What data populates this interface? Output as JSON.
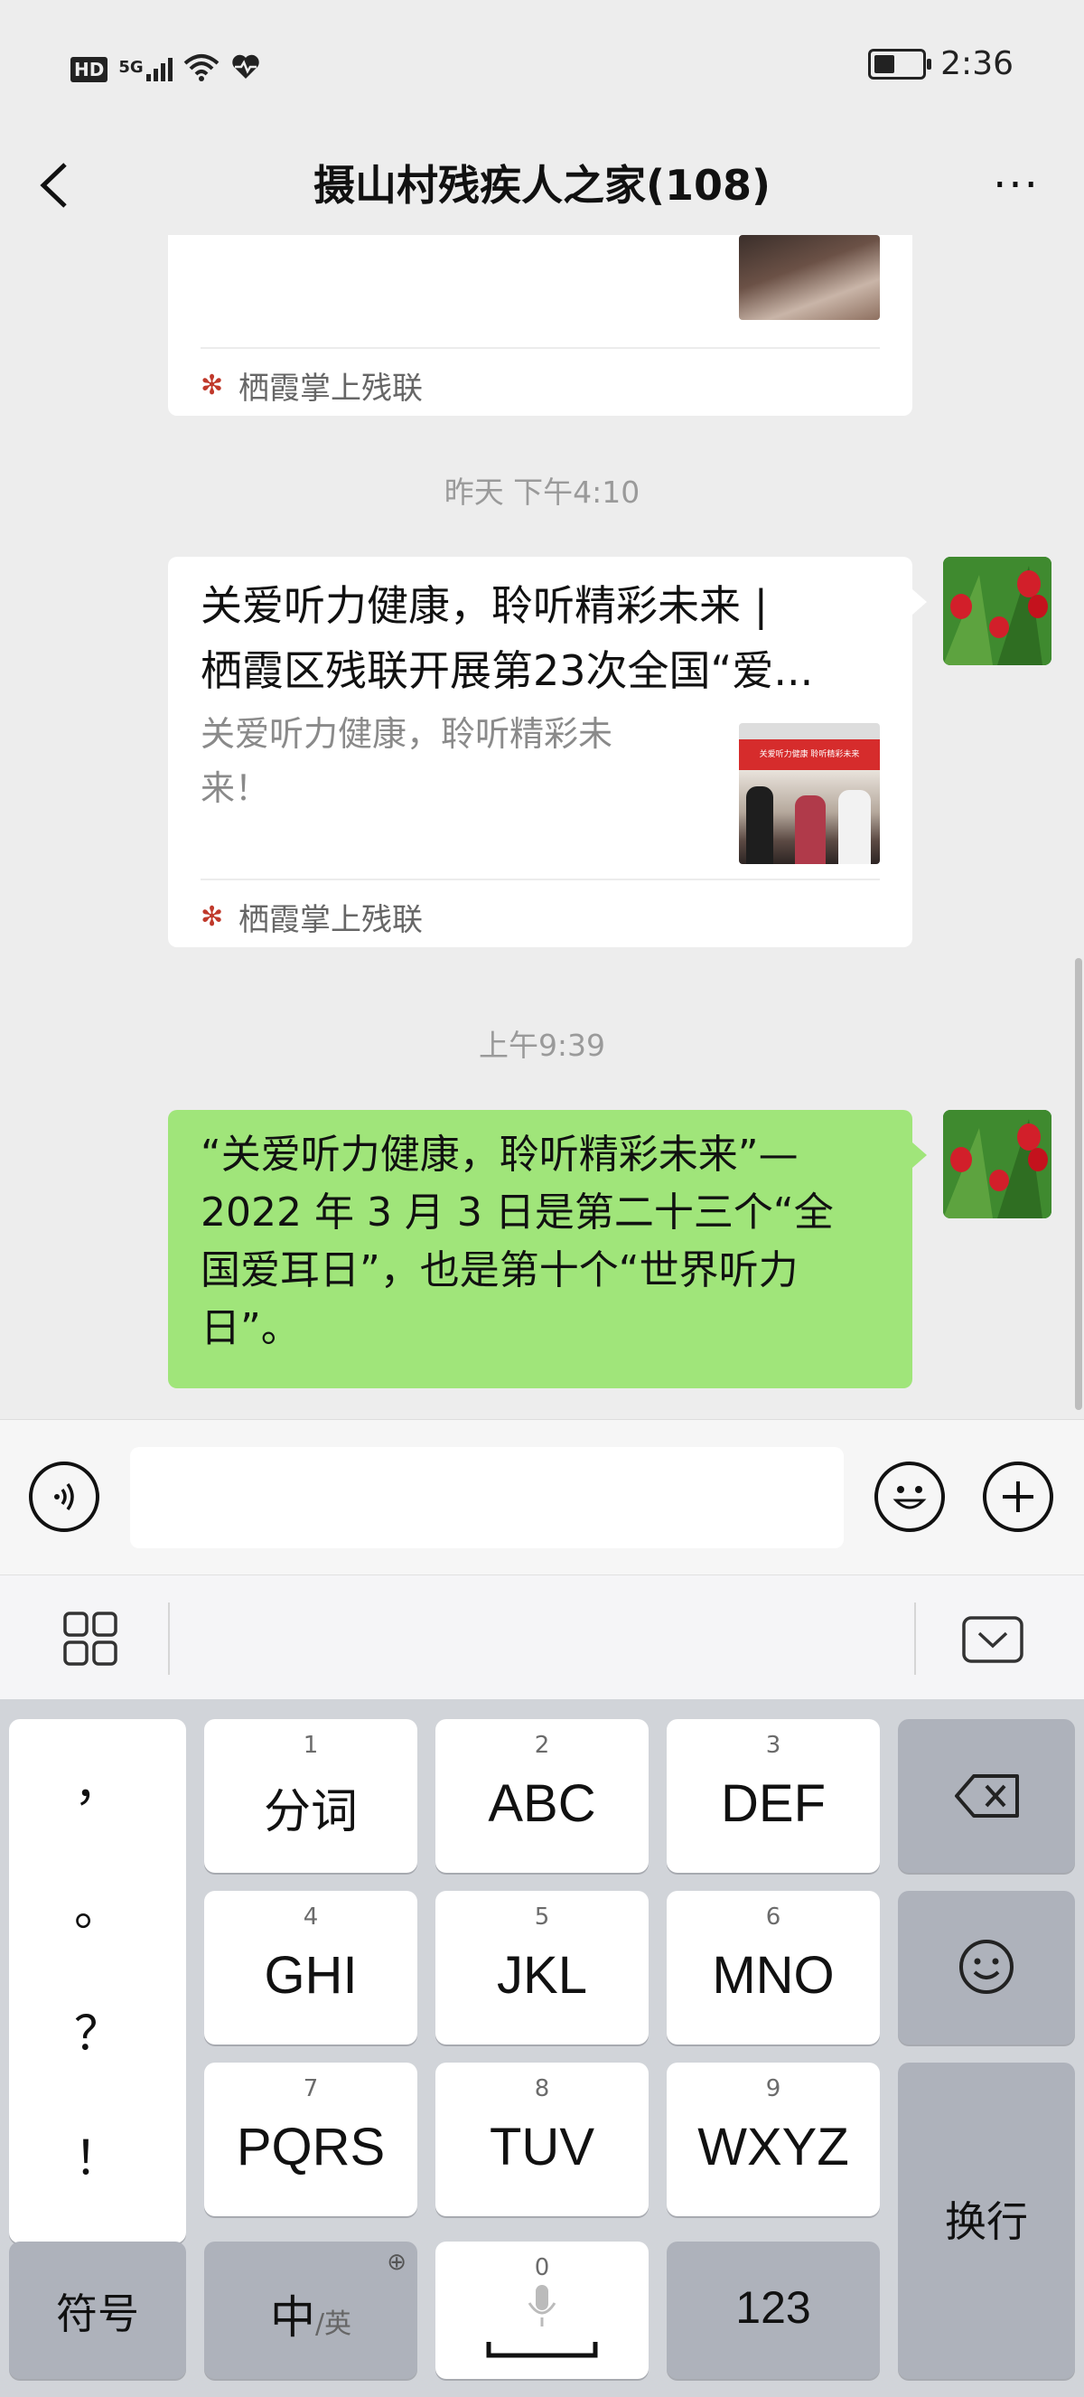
{
  "status_bar": {
    "network_hd": "HD",
    "network_5g": "5G",
    "time": "2:36"
  },
  "header": {
    "title": "摄山村残疾人之家(108)",
    "more": "···"
  },
  "chat": {
    "messages": [
      {
        "type": "article-partial",
        "source": "栖霞掌上残联"
      },
      {
        "type": "timestamp",
        "text": "昨天 下午4:10"
      },
      {
        "type": "article",
        "title_line1": "关爱听力健康，聆听精彩未来 |",
        "title_line2": "栖霞区残联开展第23次全国“爱...",
        "desc_line1": "关爱听力健康，聆听精彩未",
        "desc_line2": "来！",
        "thumb_banner": "关爱听力健康  聆听精彩未来",
        "source": "栖霞掌上残联"
      },
      {
        "type": "timestamp",
        "text": "上午9:39"
      },
      {
        "type": "text",
        "lines": [
          "“关爱听力健康，聆听精彩未来”—",
          "2022 年 3 月 3 日是第二十三个“全",
          "国爱耳日”，也是第十个“世界听力",
          "日”。"
        ]
      }
    ]
  },
  "input": {
    "placeholder": ""
  },
  "keyboard": {
    "punctuation": [
      "，",
      "。",
      "？",
      "！"
    ],
    "keys": [
      {
        "num": "1",
        "label": "分词"
      },
      {
        "num": "2",
        "label": "ABC"
      },
      {
        "num": "3",
        "label": "DEF"
      },
      {
        "num": "4",
        "label": "GHI"
      },
      {
        "num": "5",
        "label": "JKL"
      },
      {
        "num": "6",
        "label": "MNO"
      },
      {
        "num": "7",
        "label": "PQRS"
      },
      {
        "num": "8",
        "label": "TUV"
      },
      {
        "num": "9",
        "label": "WXYZ"
      }
    ],
    "symbols": "符号",
    "lang_main": "中",
    "lang_sub": "/英",
    "space_num": "0",
    "numbers": "123",
    "enter": "换行"
  }
}
